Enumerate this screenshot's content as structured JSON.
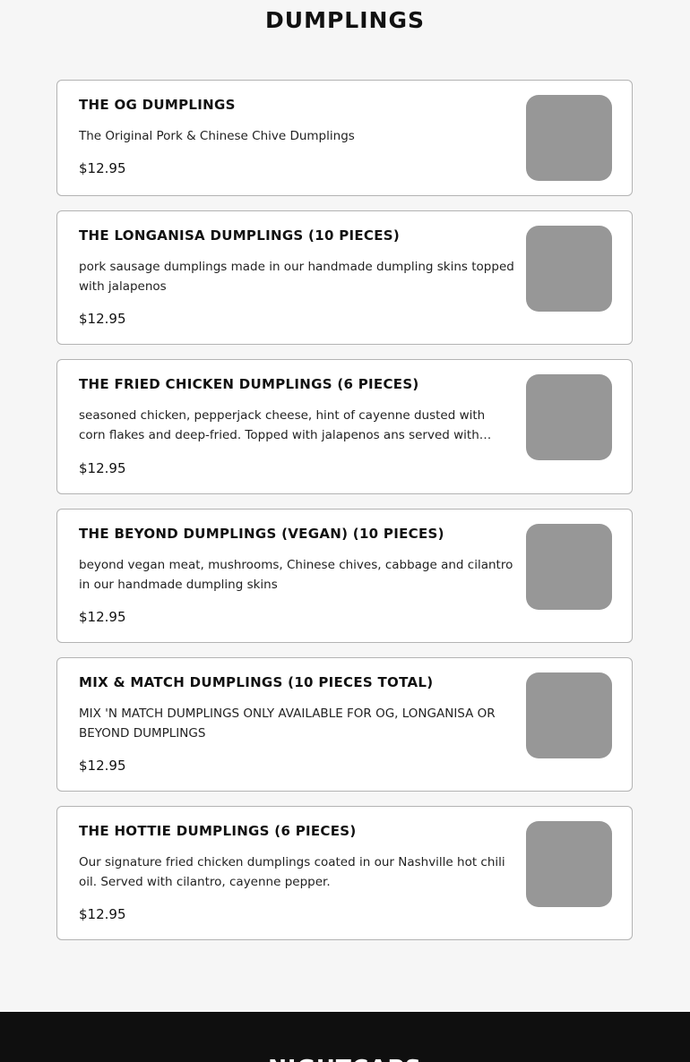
{
  "section": {
    "title": "DUMPLINGS"
  },
  "items": [
    {
      "name": "THE OG DUMPLINGS",
      "description": "The Original Pork & Chinese Chive Dumplings",
      "price": "$12.95"
    },
    {
      "name": "THE LONGANISA DUMPLINGS (10 PIECES)",
      "description": "pork sausage dumplings made in our handmade dumpling skins topped with jalapenos",
      "price": "$12.95"
    },
    {
      "name": "THE FRIED CHICKEN DUMPLINGS (6 PIECES)",
      "description": "seasoned chicken, pepperjack cheese, hint of cayenne dusted with corn flakes and deep-fried. Topped with jalapenos ans served with our…",
      "price": "$12.95"
    },
    {
      "name": "THE BEYOND DUMPLINGS (VEGAN) (10 PIECES)",
      "description": "beyond vegan meat, mushrooms, Chinese chives, cabbage and cilantro in our handmade dumpling skins",
      "price": "$12.95"
    },
    {
      "name": "MIX & MATCH DUMPLINGS (10 PIECES TOTAL)",
      "description": "MIX 'N MATCH DUMPLINGS ONLY AVAILABLE FOR OG, LONGANISA OR BEYOND DUMPLINGS",
      "price": "$12.95"
    },
    {
      "name": "THE HOTTIE DUMPLINGS (6 PIECES)",
      "description": "Our signature fried chicken dumplings coated in our Nashville hot chili oil. Served with cilantro, cayenne pepper.",
      "price": "$12.95"
    }
  ],
  "footer": {
    "title": "NIGHTCAPS"
  },
  "colors": {
    "page_background": "#f6f6f6",
    "card_background": "#ffffff",
    "card_border": "#b3b3b3",
    "thumbnail_placeholder": "#979797",
    "footer_background": "#0f0f0f"
  }
}
